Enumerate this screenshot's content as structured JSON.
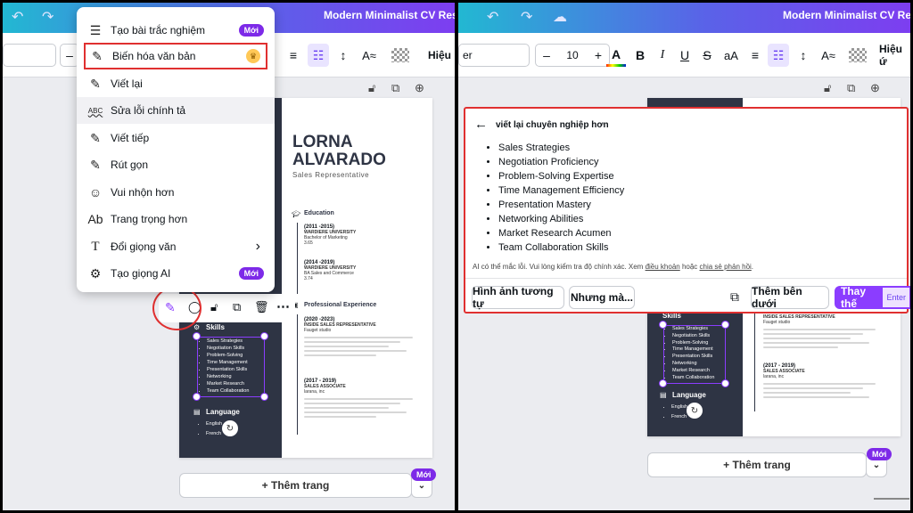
{
  "left": {
    "doc_title": "Modern Minimalist CV Resum",
    "toolbar": {
      "dash": "–",
      "effects": "Hiệu"
    },
    "menu": [
      {
        "icon": "☰",
        "label": "Tạo bài trắc nghiệm",
        "badge": "Mới"
      },
      {
        "icon": "✎",
        "label": "Biến hóa văn bản",
        "badge": "♛"
      },
      {
        "icon": "✎",
        "label": "Viết lại"
      },
      {
        "icon": "ABC",
        "label": "Sửa lỗi chính tả"
      },
      {
        "icon": "✎",
        "label": "Viết tiếp"
      },
      {
        "icon": "✎",
        "label": "Rút gọn"
      },
      {
        "icon": "☺",
        "label": "Vui nhộn hơn"
      },
      {
        "icon": "Ab",
        "label": "Trang trọng hơn"
      },
      {
        "icon": "T",
        "label": "Đổi giọng văn",
        "chevron": "›"
      },
      {
        "icon": "⚙",
        "label": "Tạo giọng AI",
        "badge": "Mới"
      }
    ],
    "resume": {
      "first": "LORNA",
      "last": "ALVARADO",
      "role": "Sales Representative",
      "education": "Education",
      "edu": [
        {
          "years": "(2011 -2015)",
          "school": "WARDIERE UNIVERSITY",
          "degree": "Bachelor of Marketing",
          "gpa": "3.65"
        },
        {
          "years": "(2014 -2019)",
          "school": "WARDIERE UNIVERSITY",
          "degree": "BA Sales and Commerce",
          "gpa": "3.74"
        }
      ],
      "experience": "Professional Experience",
      "exp": [
        {
          "years": "(2020 -2023)",
          "title": "INSIDE SALES REPRESENTATIVE",
          "company": "Fauget studio"
        },
        {
          "years": "(2017 - 2019)",
          "title": "SALES ASSOCIATE",
          "company": "larana, inc"
        }
      ],
      "skills_h": "Skills",
      "skills": [
        "Sales Strategies",
        "Negotiation Skills",
        "Problem-Solving",
        "Time Management",
        "Presentation Skills",
        "Networking",
        "Market Research",
        "Team Collaboration"
      ],
      "language_h": "Language",
      "languages": [
        "English",
        "French"
      ]
    },
    "add_page": "+ Thêm trang",
    "new_badge": "Mới"
  },
  "right": {
    "doc_title": "Modern Minimalist CV Resum",
    "toolbar": {
      "font_size": "10",
      "minus": "–",
      "plus": "+",
      "effects": "Hiệu ứ",
      "font": "er"
    },
    "panel": {
      "back_title": "viết lại chuyên nghiệp hơn",
      "items": [
        "Sales Strategies",
        "Negotiation Proficiency",
        "Problem-Solving Expertise",
        "Time Management Efficiency",
        "Presentation Mastery",
        "Networking Abilities",
        "Market Research Acumen",
        "Team Collaboration Skills"
      ],
      "disclaimer_a": "AI có thể mắc lỗi. Vui lòng kiểm tra độ chính xác. Xem ",
      "terms": "điều khoản",
      "disclaimer_b": " hoặc ",
      "feedback": "chia sẻ phản hồi",
      "disclaimer_c": ".",
      "btn_similar": "Hình ảnh tương tự",
      "btn_but": "Nhưng mà...",
      "btn_add_below": "Thêm bên dưới",
      "btn_replace": "Thay thế",
      "enter": "Enter"
    },
    "resume": {
      "skills_h": "Skills",
      "skills": [
        "Sales Strategies",
        "Negotiation Skills",
        "Problem-Solving",
        "Time Management",
        "Presentation Skills",
        "Networking",
        "Market Research",
        "Team Collaboration"
      ],
      "language_h": "Language",
      "languages": [
        "English",
        "French"
      ],
      "exp_title": "INSIDE SALES REPRESENTATIVE",
      "exp_company": "Fauget studio",
      "exp2_years": "(2017 - 2019)",
      "exp2_title": "SALES ASSOCIATE",
      "exp2_company": "larana, inc"
    },
    "add_page": "+ Thêm trang",
    "new_badge": "Mới"
  },
  "colors": {
    "accent": "#8b3dff",
    "badge": "#7d2ae8",
    "red_outline": "#e03030",
    "sidebar": "#2e3444"
  }
}
